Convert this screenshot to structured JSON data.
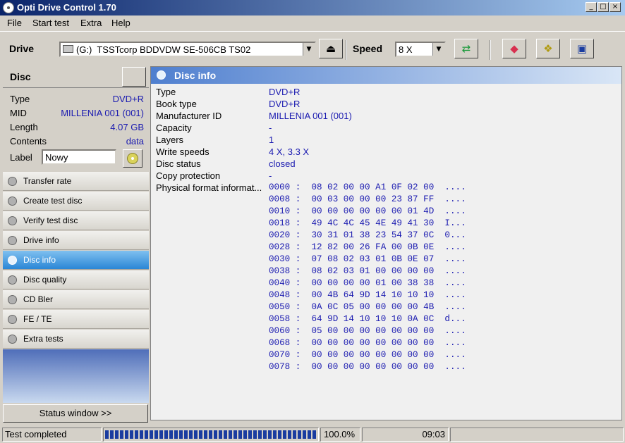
{
  "window": {
    "title": "Opti Drive Control 1.70"
  },
  "menu": [
    "File",
    "Start test",
    "Extra",
    "Help"
  ],
  "toolbar": {
    "drive_label": "Drive",
    "drive_value": "(G:)  TSSTcorp BDDVDW SE-506CB TS02",
    "speed_label": "Speed",
    "speed_value": "8 X",
    "icons": [
      "eject-icon",
      "refresh-icon",
      "eraser-icon",
      "copy-icon",
      "save-icon"
    ]
  },
  "disc": {
    "title": "Disc",
    "rows": [
      {
        "key": "Type",
        "value": "DVD+R"
      },
      {
        "key": "MID",
        "value": "MILLENIA 001 (001)"
      },
      {
        "key": "Length",
        "value": "4.07 GB"
      },
      {
        "key": "Contents",
        "value": "data"
      }
    ],
    "label_key": "Label",
    "label_value": "Nowy"
  },
  "nav": [
    {
      "label": "Transfer rate",
      "active": false
    },
    {
      "label": "Create test disc",
      "active": false
    },
    {
      "label": "Verify test disc",
      "active": false
    },
    {
      "label": "Drive info",
      "active": false
    },
    {
      "label": "Disc info",
      "active": true
    },
    {
      "label": "Disc quality",
      "active": false
    },
    {
      "label": "CD Bler",
      "active": false
    },
    {
      "label": "FE / TE",
      "active": false
    },
    {
      "label": "Extra tests",
      "active": false
    }
  ],
  "status_window_label": "Status window >>",
  "main": {
    "title": "Disc info",
    "rows": [
      {
        "key": "Type",
        "value": "DVD+R"
      },
      {
        "key": "Book type",
        "value": "DVD+R"
      },
      {
        "key": "Manufacturer ID",
        "value": "MILLENIA 001 (001)"
      },
      {
        "key": "Capacity",
        "value": "-"
      },
      {
        "key": "Layers",
        "value": "1"
      },
      {
        "key": "Write speeds",
        "value": "4 X, 3.3 X"
      },
      {
        "key": "Disc status",
        "value": "closed"
      },
      {
        "key": "Copy protection",
        "value": "-"
      },
      {
        "key": "Physical format informat...",
        "value": ""
      }
    ],
    "hex": [
      "0000 :  08 02 00 00 A1 0F 02 00  ....",
      "0008 :  00 03 00 00 00 23 87 FF  ....",
      "0010 :  00 00 00 00 00 00 01 4D  ....",
      "0018 :  49 4C 4C 45 4E 49 41 30  I...",
      "0020 :  30 31 01 38 23 54 37 0C  0...",
      "0028 :  12 82 00 26 FA 00 0B 0E  ....",
      "0030 :  07 08 02 03 01 0B 0E 07  ....",
      "0038 :  08 02 03 01 00 00 00 00  ....",
      "0040 :  00 00 00 00 01 00 38 38  ....",
      "0048 :  00 4B 64 9D 14 10 10 10  ....",
      "0050 :  0A 0C 05 00 00 00 00 4B  ....",
      "0058 :  64 9D 14 10 10 10 0A 0C  d...",
      "0060 :  05 00 00 00 00 00 00 00  ....",
      "0068 :  00 00 00 00 00 00 00 00  ....",
      "0070 :  00 00 00 00 00 00 00 00  ....",
      "0078 :  00 00 00 00 00 00 00 00  ...."
    ]
  },
  "statusbar": {
    "status": "Test completed",
    "progress_fraction": 1.0,
    "progress_text": "100.0%",
    "time": "09:03"
  }
}
